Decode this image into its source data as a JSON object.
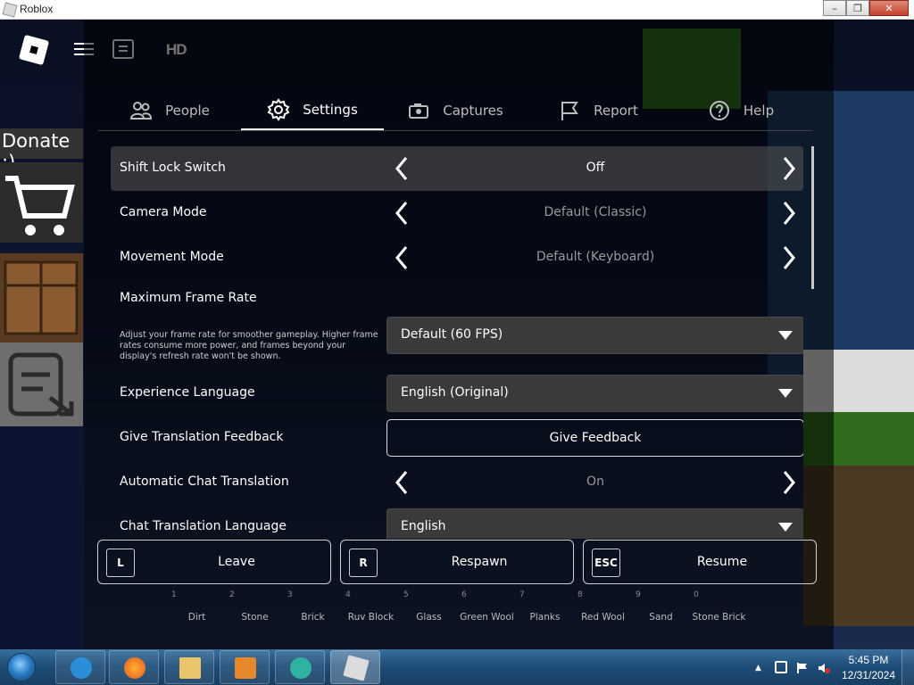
{
  "window": {
    "title": "Roblox",
    "controls": [
      "minimize",
      "restore",
      "close"
    ]
  },
  "topbar": {
    "hd_label": "HD"
  },
  "hud": {
    "donate": "Donate :)"
  },
  "tabs": [
    {
      "label": "People",
      "icon": "people-icon",
      "active": false
    },
    {
      "label": "Settings",
      "icon": "gear-icon",
      "active": true
    },
    {
      "label": "Captures",
      "icon": "camera-icon",
      "active": false
    },
    {
      "label": "Report",
      "icon": "flag-icon",
      "active": false
    },
    {
      "label": "Help",
      "icon": "help-icon",
      "active": false
    }
  ],
  "settings": {
    "shift_lock": {
      "label": "Shift Lock Switch",
      "value": "Off"
    },
    "camera_mode": {
      "label": "Camera Mode",
      "value": "Default (Classic)"
    },
    "movement_mode": {
      "label": "Movement Mode",
      "value": "Default (Keyboard)"
    },
    "frame_rate": {
      "label": "Maximum Frame Rate",
      "description": "Adjust your frame rate for smoother gameplay. Higher frame rates consume more power, and frames beyond your display's refresh rate won't be shown.",
      "value": "Default (60 FPS)"
    },
    "experience_language": {
      "label": "Experience Language",
      "value": "English (Original)"
    },
    "translation_feedback": {
      "label": "Give Translation Feedback",
      "button": "Give Feedback"
    },
    "auto_chat_translation": {
      "label": "Automatic Chat Translation",
      "value": "On"
    },
    "chat_translation_language": {
      "label": "Chat Translation Language",
      "value": "English"
    }
  },
  "actions": [
    {
      "key": "L",
      "label": "Leave"
    },
    {
      "key": "R",
      "label": "Respawn"
    },
    {
      "key": "ESC",
      "label": "Resume"
    }
  ],
  "hotbar": [
    {
      "num": "1",
      "name": "Dirt"
    },
    {
      "num": "2",
      "name": "Stone"
    },
    {
      "num": "3",
      "name": "Brick"
    },
    {
      "num": "4",
      "name": "Ruv Block"
    },
    {
      "num": "5",
      "name": "Glass"
    },
    {
      "num": "6",
      "name": "Green Wool"
    },
    {
      "num": "7",
      "name": "Planks"
    },
    {
      "num": "8",
      "name": "Red Wool"
    },
    {
      "num": "9",
      "name": "Sand"
    },
    {
      "num": "0",
      "name": "Stone Brick"
    }
  ],
  "taskbar": {
    "time": "5:45 PM",
    "date": "12/31/2024",
    "apps": [
      "internet-explorer",
      "firefox",
      "file-explorer",
      "media-player",
      "roblox-studio",
      "roblox"
    ]
  },
  "colors": {
    "panel_bg": "#000000",
    "selected_row": "#5a5a5a",
    "taskbar": "#1f4e79"
  }
}
